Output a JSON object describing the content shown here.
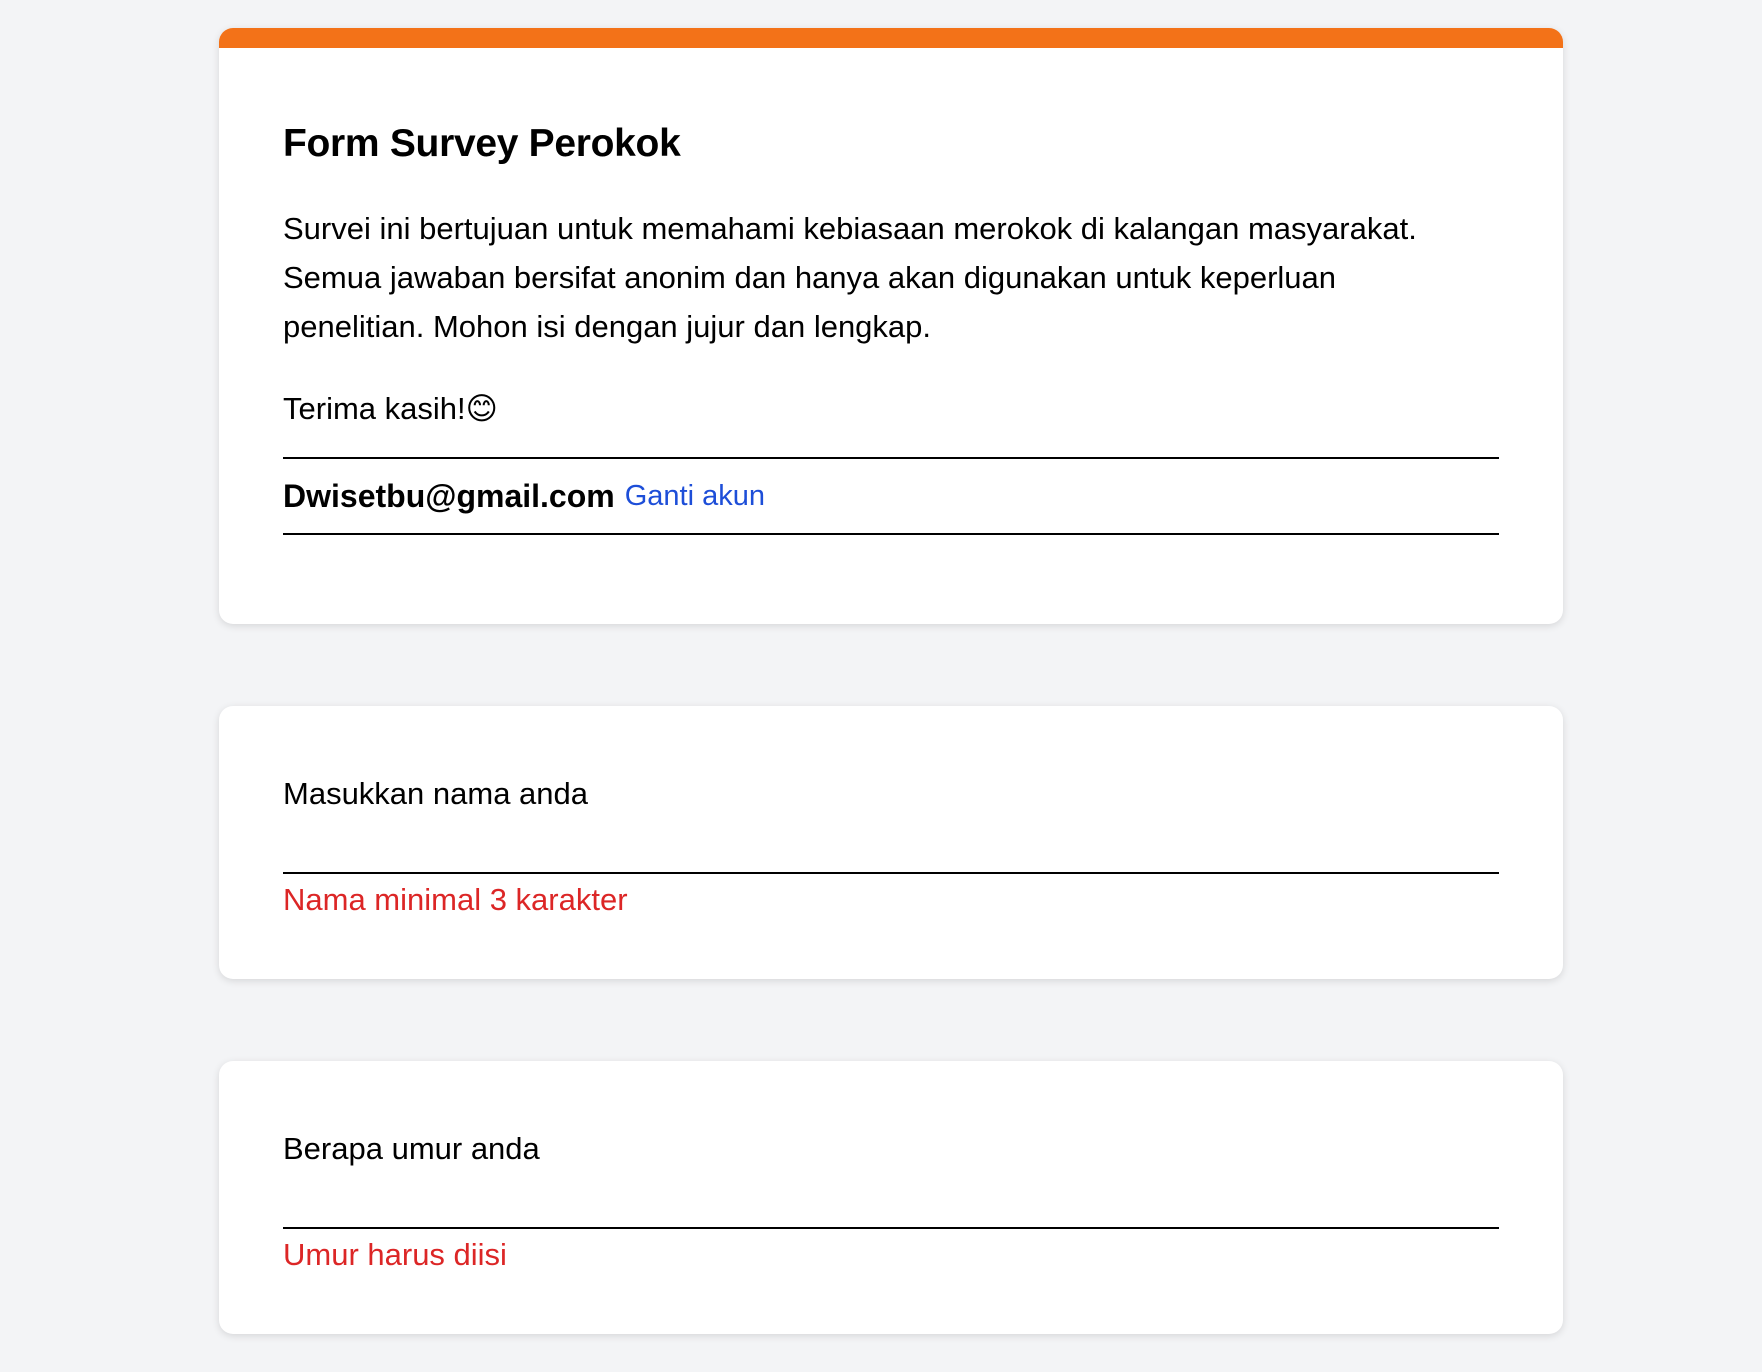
{
  "form": {
    "title": "Form Survey Perokok",
    "description": "Survei ini bertujuan untuk memahami kebiasaan merokok di kalangan masyarakat.\nSemua jawaban bersifat anonim dan hanya akan digunakan untuk keperluan\npenelitian. Mohon isi dengan jujur dan lengkap.",
    "thanks": "Terima kasih!😊",
    "accent_color": "#f37218"
  },
  "account": {
    "email": "Dwisetbu@gmail.com",
    "switch_label": "Ganti akun",
    "link_color": "#1d4ed8"
  },
  "questions": [
    {
      "label": "Masukkan nama anda",
      "value": "",
      "error": "Nama minimal 3 karakter"
    },
    {
      "label": "Berapa umur anda",
      "value": "",
      "error": "Umur harus diisi"
    }
  ],
  "colors": {
    "background": "#f3f4f6",
    "error": "#dc2626"
  }
}
